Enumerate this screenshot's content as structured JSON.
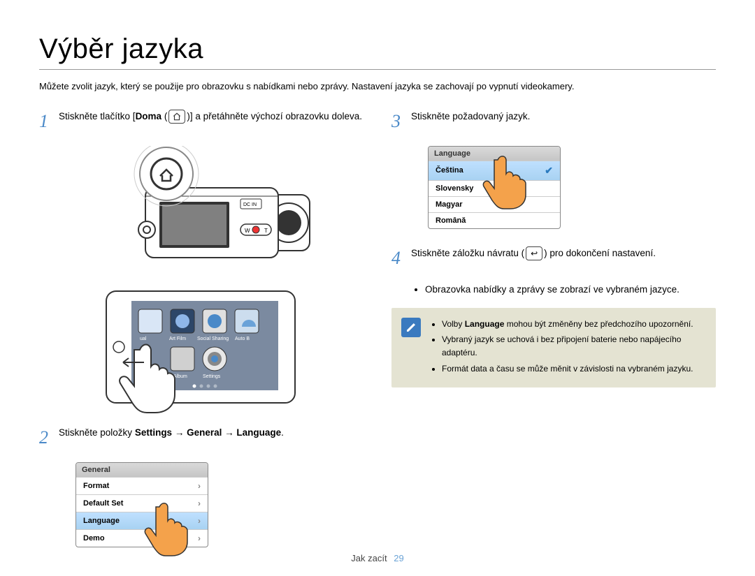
{
  "title": "Výběr jazyka",
  "intro": "Můžete zvolit jazyk, který se použije pro obrazovku s nabídkami nebo zprávy. Nastavení jazyka se zachovají po vypnutí videokamery.",
  "step1": {
    "num": "1",
    "text_a": "Stiskněte tlačítko [",
    "bold": "Doma",
    "text_b": " (",
    "text_c": ")] a přetáhněte výchozí obrazovku doleva."
  },
  "step2": {
    "num": "2",
    "text_a": "Stiskněte položky ",
    "b1": "Settings",
    "arrow": " → ",
    "b2": "General",
    "b3": "Language",
    "text_end": "."
  },
  "step3": {
    "num": "3",
    "text": "Stiskněte požadovaný jazyk."
  },
  "step4": {
    "num": "4",
    "text_a": "Stiskněte záložku návratu (",
    "text_b": ") pro dokončení nastavení.",
    "sub": "Obrazovka nabídky a zprávy se zobrazí ve vybraném jazyce."
  },
  "menu_general": {
    "header": "General",
    "items": [
      "Format",
      "Default Set",
      "Language",
      "Demo"
    ],
    "selected": "Language"
  },
  "menu_language": {
    "header": "Language",
    "items": [
      "Čeština",
      "Slovensky",
      "Magyar",
      "Română"
    ],
    "selected": "Čeština"
  },
  "home_icons": {
    "row1": [
      "ual",
      "Art Film",
      "Social Sharing",
      "Auto B"
    ],
    "row2": [
      "Album",
      "Settings"
    ]
  },
  "camera_label": "DC IN",
  "camera_buttons": {
    "w": "W",
    "t": "T"
  },
  "note": {
    "items": [
      {
        "pre": "Volby ",
        "b": "Language",
        "post": " mohou být změněny bez předchozího upozornění."
      },
      {
        "text": "Vybraný jazyk se uchová i bez připojení baterie nebo napájecího adaptéru."
      },
      {
        "text": "Formát data a času se může měnit v závislosti na vybraném jazyku."
      }
    ]
  },
  "footer": {
    "section": "Jak zacít",
    "page": "29"
  }
}
